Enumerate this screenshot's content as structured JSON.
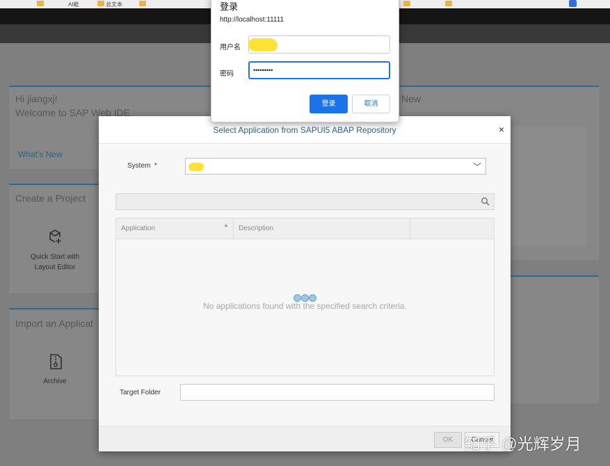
{
  "bookmarks_bar": {
    "items": [
      "AI能",
      "总文本"
    ]
  },
  "web_ide": {
    "welcome_tile": {
      "greeting": "Hi jiangxj!",
      "welcome": "Welcome to SAP Web IDE",
      "whats_new_link": "What's New"
    },
    "right_tile": {
      "heading": "New"
    },
    "create_project_tile": {
      "heading": "Create a Project",
      "action_label": "Quick Start with Layout Editor"
    },
    "import_tile": {
      "heading": "Import an Applicat",
      "action_label": "Archive"
    }
  },
  "dialog": {
    "title": "Select Application from SAPUI5 ABAP Repository",
    "close_icon": "close-icon",
    "system_label": "System",
    "required_mark": "*",
    "system_value": "",
    "search_placeholder": "",
    "table": {
      "columns": [
        "Application",
        "Description"
      ],
      "no_data_text": "No applications found with the specified search criteria."
    },
    "target_folder_label": "Target Folder",
    "target_folder_value": "",
    "ok_label": "OK",
    "cancel_label": "Cancel"
  },
  "auth_dialog": {
    "title": "登录",
    "origin": "http://localhost:11111",
    "username_label": "用户名",
    "username_value": "",
    "password_label": "密码",
    "password_value": "•••••••••",
    "login_label": "登录",
    "cancel_label": "取消",
    "accent_color": "#1a73e8"
  },
  "watermark": "知乎 @光辉岁月"
}
